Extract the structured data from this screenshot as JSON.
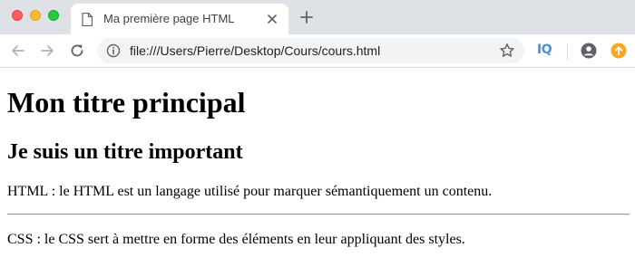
{
  "browser": {
    "tab": {
      "title": "Ma première page HTML"
    },
    "address_bar": {
      "url": "file:///Users/Pierre/Desktop/Cours/cours.html"
    },
    "extension_label": "IQ",
    "colors": {
      "tabstrip": "#dee1e6",
      "close": "#fe5f57",
      "minimize": "#febc2e",
      "zoom": "#28c840",
      "update_badge": "#f5a623"
    }
  },
  "page": {
    "h1": "Mon titre principal",
    "h2": "Je suis un titre important",
    "paragraph_1": "HTML : le HTML est un langage utilisé pour marquer sémantiquement un contenu.",
    "paragraph_2": "CSS : le CSS sert à mettre en forme des éléments en leur appliquant des styles."
  }
}
